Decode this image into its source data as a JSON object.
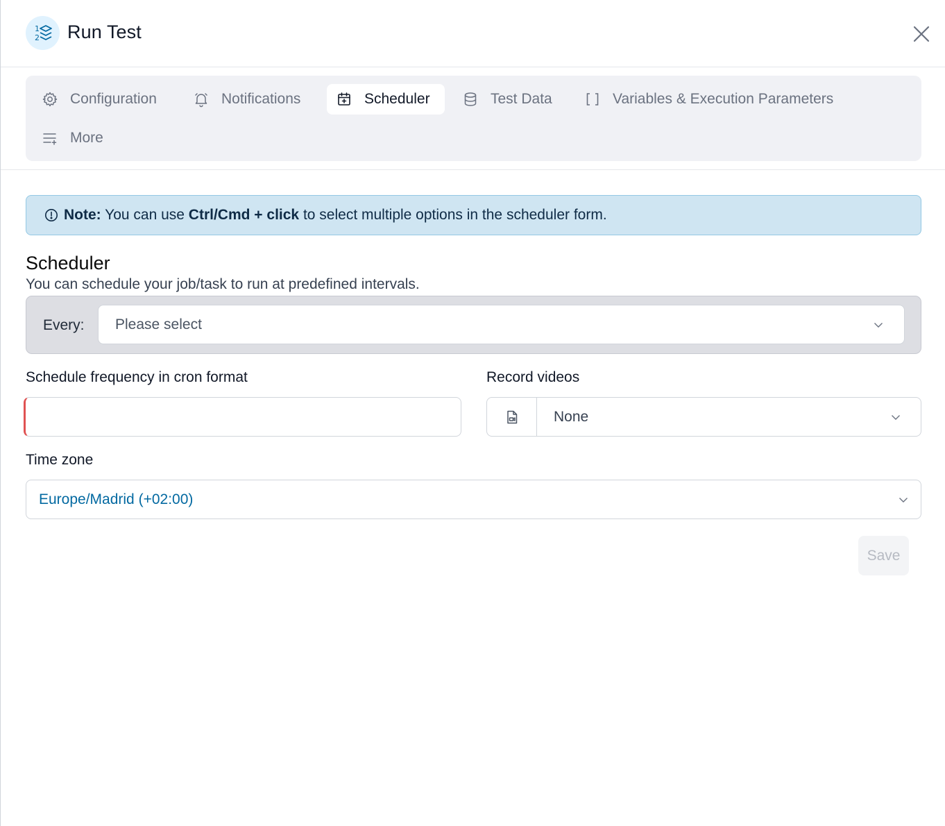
{
  "header": {
    "title": "Run Test"
  },
  "tabs": [
    {
      "label": "Configuration",
      "icon": "gear-icon"
    },
    {
      "label": "Notifications",
      "icon": "bell-icon"
    },
    {
      "label": "Scheduler",
      "icon": "calendar-plus-icon",
      "active": true
    },
    {
      "label": "Test Data",
      "icon": "database-icon"
    },
    {
      "label": "Variables & Execution Parameters",
      "icon": "brackets-icon"
    },
    {
      "label": "More",
      "icon": "list-plus-icon"
    }
  ],
  "note": {
    "prefix": "Note:",
    "text_before": " You can use ",
    "shortcut": "Ctrl/Cmd + click",
    "text_after": " to select multiple options in the scheduler form."
  },
  "scheduler": {
    "title": "Scheduler",
    "subtitle": "You can schedule your job/task to run at predefined intervals.",
    "every_label": "Every:",
    "every_placeholder": "Please select",
    "cron_label": "Schedule frequency in cron format",
    "cron_value": "",
    "record_label": "Record videos",
    "record_value": "None",
    "timezone_label": "Time zone",
    "timezone_value": "Europe/Madrid (+02:00)",
    "save_label": "Save"
  },
  "colors": {
    "accent": "#0369a1",
    "note_bg": "#cfe5f2",
    "error": "#e05252"
  }
}
